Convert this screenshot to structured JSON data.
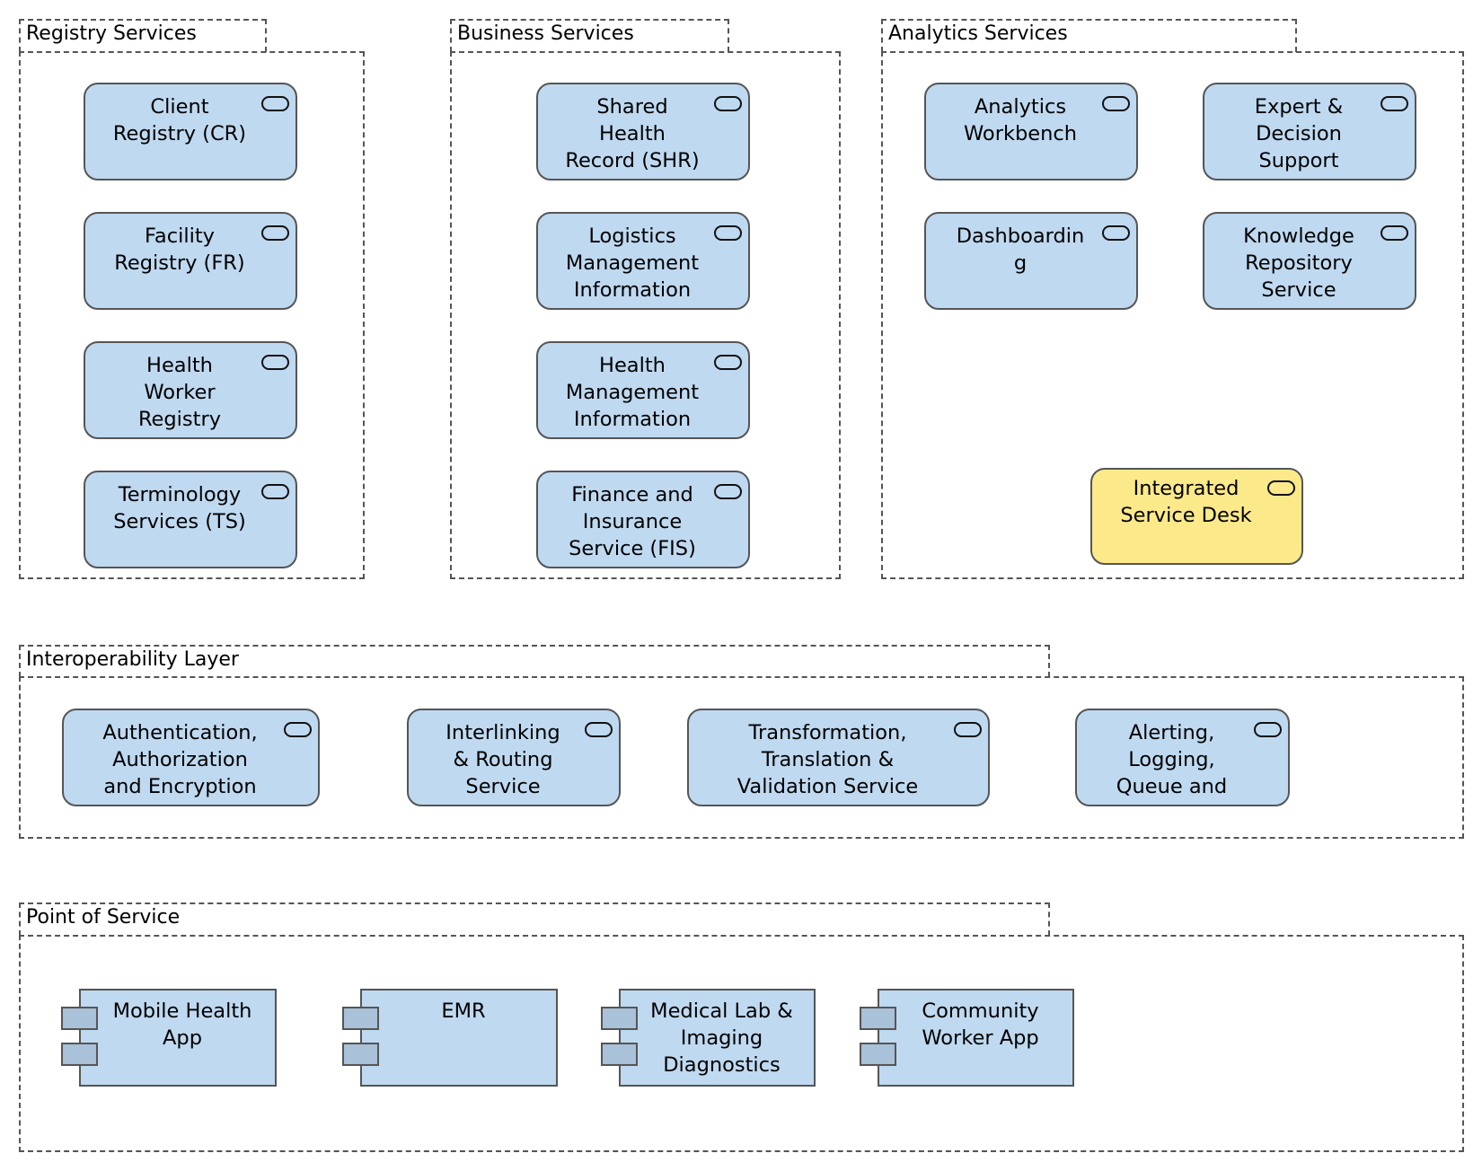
{
  "groups": {
    "registry": {
      "title": "Registry Services",
      "services": [
        {
          "label": "Client\nRegistry (CR)"
        },
        {
          "label": "Facility\nRegistry (FR)"
        },
        {
          "label": "Health\nWorker\nRegistry"
        },
        {
          "label": "Terminology\nServices (TS)"
        }
      ]
    },
    "business": {
      "title": "Business Services",
      "services": [
        {
          "label": "Shared\nHealth\nRecord (SHR)"
        },
        {
          "label": "Logistics\nManagement\nInformation"
        },
        {
          "label": "Health\nManagement\nInformation"
        },
        {
          "label": "Finance and\nInsurance\nService (FIS)"
        }
      ]
    },
    "analytics": {
      "title": "Analytics Services",
      "services": [
        {
          "label": "Analytics\nWorkbench"
        },
        {
          "label": "Expert &\nDecision\nSupport"
        },
        {
          "label": "Dashboardin\ng"
        },
        {
          "label": "Knowledge\nRepository\nService"
        },
        {
          "label": "Integrated\nService Desk",
          "fill": "#fbe98a"
        }
      ]
    },
    "interoperability": {
      "title": "Interoperability Layer",
      "services": [
        {
          "label": "Authentication,\nAuthorization\nand Encryption"
        },
        {
          "label": "Interlinking\n& Routing\nService"
        },
        {
          "label": "Transformation,\nTranslation &\nValidation Service"
        },
        {
          "label": "Alerting,\nLogging,\nQueue and"
        }
      ]
    },
    "point_of_service": {
      "title": "Point of Service",
      "components": [
        {
          "label": "Mobile Health\nApp"
        },
        {
          "label": "EMR"
        },
        {
          "label": "Medical Lab &\nImaging\nDiagnostics"
        },
        {
          "label": "Community\nWorker App"
        }
      ]
    }
  },
  "colors": {
    "service_fill": "#bfd9f0",
    "highlight_fill": "#fbe98a",
    "port_fill": "#a9c1d9",
    "border": "#555555"
  }
}
